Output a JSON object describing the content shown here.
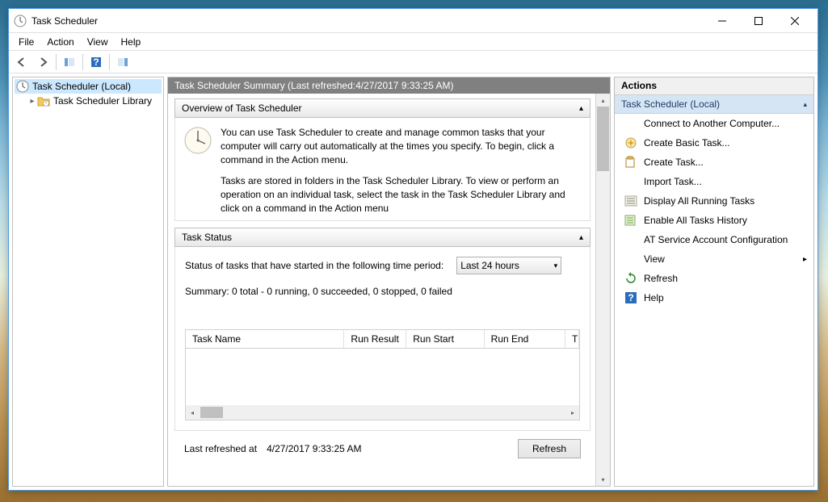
{
  "title": "Task Scheduler",
  "menu": {
    "file": "File",
    "action": "Action",
    "view": "View",
    "help": "Help"
  },
  "tree": {
    "root": "Task Scheduler (Local)",
    "child": "Task Scheduler Library"
  },
  "summary": {
    "header_prefix": "Task Scheduler Summary (Last refreshed: ",
    "header_time": "4/27/2017 9:33:25 AM",
    "header_suffix": ")",
    "overview_title": "Overview of Task Scheduler",
    "overview_p1": "You can use Task Scheduler to create and manage common tasks that your computer will carry out automatically at the times you specify. To begin, click a command in the Action menu.",
    "overview_p2": "Tasks are stored in folders in the Task Scheduler Library. To view or perform an operation on an individual task, select the task in the Task Scheduler Library and click on a command in the Action menu",
    "status_title": "Task Status",
    "status_period_label": "Status of tasks that have started in the following time period:",
    "status_period_value": "Last 24 hours",
    "status_summary": "Summary: 0 total - 0 running, 0 succeeded, 0 stopped, 0 failed",
    "cols": {
      "name": "Task Name",
      "result": "Run Result",
      "start": "Run Start",
      "end": "Run End",
      "t": "T"
    },
    "last_refreshed_prefix": "Last refreshed at ",
    "last_refreshed_time": "4/27/2017 9:33:25 AM",
    "refresh_btn": "Refresh"
  },
  "actions": {
    "title": "Actions",
    "section": "Task Scheduler (Local)",
    "items": {
      "connect": "Connect to Another Computer...",
      "basic": "Create Basic Task...",
      "create": "Create Task...",
      "import": "Import Task...",
      "display_running": "Display All Running Tasks",
      "enable_history": "Enable All Tasks History",
      "at_config": "AT Service Account Configuration",
      "view": "View",
      "refresh": "Refresh",
      "help": "Help"
    }
  }
}
